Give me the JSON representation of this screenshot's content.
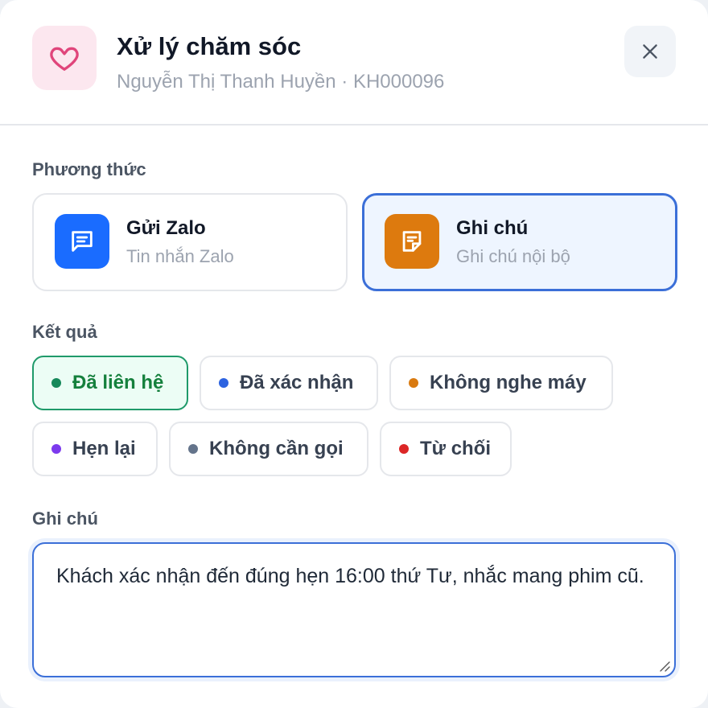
{
  "header": {
    "title": "Xử lý chăm sóc",
    "subtitle": "Nguyễn Thị Thanh Huyền · KH000096",
    "icon": "heart-icon",
    "close_icon": "close-icon"
  },
  "method": {
    "label": "Phương thức",
    "options": [
      {
        "title": "Gửi Zalo",
        "desc": "Tin nhắn Zalo",
        "icon": "chat-icon",
        "color": "#1a6cff",
        "selected": false
      },
      {
        "title": "Ghi chú",
        "desc": "Ghi chú nội bộ",
        "icon": "note-icon",
        "color": "#dd7a0e",
        "selected": true
      }
    ]
  },
  "result": {
    "label": "Kết quả",
    "options": [
      {
        "label": "Đã liên hệ",
        "dot_color": "#16895a",
        "selected": true
      },
      {
        "label": "Đã xác nhận",
        "dot_color": "#2d63e0",
        "selected": false
      },
      {
        "label": "Không nghe máy",
        "dot_color": "#d97a10",
        "selected": false
      },
      {
        "label": "Hẹn lại",
        "dot_color": "#7c3aed",
        "selected": false
      },
      {
        "label": "Không cần gọi",
        "dot_color": "#64748b",
        "selected": false
      },
      {
        "label": "Từ chối",
        "dot_color": "#dc2626",
        "selected": false
      }
    ]
  },
  "note": {
    "label": "Ghi chú",
    "value": "Khách xác nhận đến đúng hẹn 16:00 thứ Tư, nhắc mang phim cũ."
  }
}
